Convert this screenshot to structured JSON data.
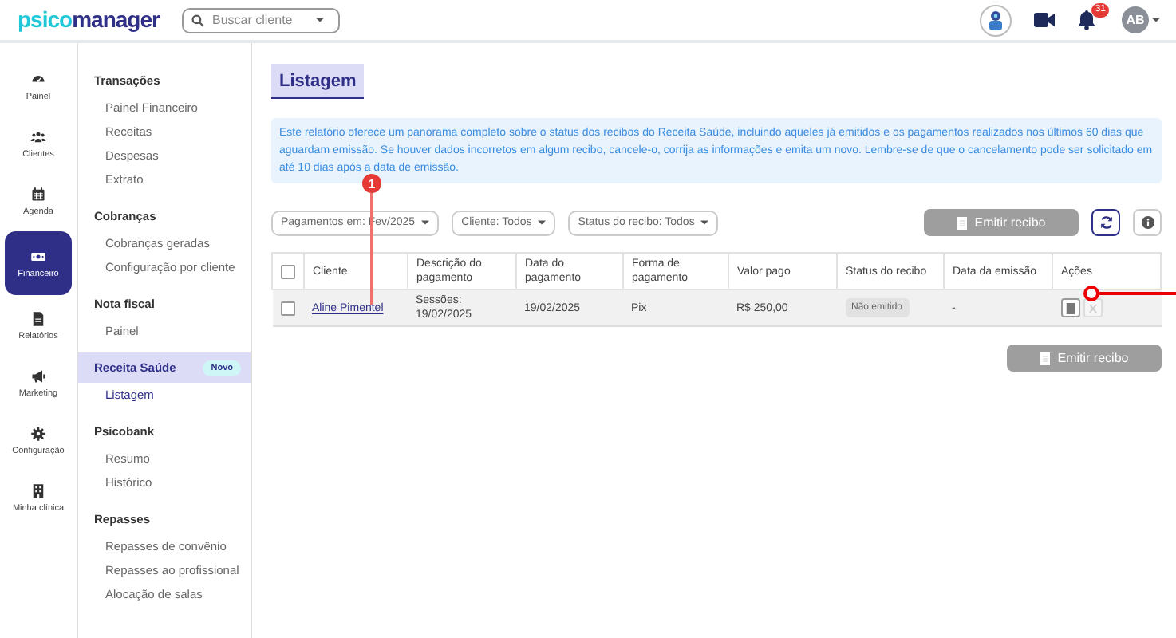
{
  "header": {
    "logo": {
      "prefix": "psico",
      "suffix": "manager"
    },
    "search": {
      "placeholder": "Buscar cliente"
    },
    "notifications": "31",
    "avatar": "AB"
  },
  "rail": [
    {
      "label": "Painel",
      "selected": false
    },
    {
      "label": "Clientes",
      "selected": false
    },
    {
      "label": "Agenda",
      "selected": false
    },
    {
      "label": "Financeiro",
      "selected": true
    },
    {
      "label": "Relatórios",
      "selected": false
    },
    {
      "label": "Marketing",
      "selected": false
    },
    {
      "label": "Configuração",
      "selected": false
    },
    {
      "label": "Minha clínica",
      "selected": false
    }
  ],
  "submenu": [
    {
      "title": "Transações",
      "selected": false,
      "items": [
        {
          "label": "Painel Financeiro",
          "selected": false
        },
        {
          "label": "Receitas",
          "selected": false
        },
        {
          "label": "Despesas",
          "selected": false
        },
        {
          "label": "Extrato",
          "selected": false
        }
      ]
    },
    {
      "title": "Cobranças",
      "selected": false,
      "items": [
        {
          "label": "Cobranças geradas",
          "selected": false
        },
        {
          "label": "Configuração por cliente",
          "selected": false
        }
      ]
    },
    {
      "title": "Nota fiscal",
      "selected": false,
      "items": [
        {
          "label": "Painel",
          "selected": false
        }
      ]
    },
    {
      "title": "Receita Saúde",
      "selected": true,
      "badge": "Novo",
      "items": [
        {
          "label": "Listagem",
          "selected": true
        }
      ]
    },
    {
      "title": "Psicobank",
      "selected": false,
      "items": [
        {
          "label": "Resumo",
          "selected": false
        },
        {
          "label": "Histórico",
          "selected": false
        }
      ]
    },
    {
      "title": "Repasses",
      "selected": false,
      "items": [
        {
          "label": "Repasses de convênio",
          "selected": false
        },
        {
          "label": "Repasses ao profissional",
          "selected": false
        },
        {
          "label": "Alocação de salas",
          "selected": false
        }
      ]
    }
  ],
  "page": {
    "title": "Listagem",
    "info": "Este relatório oferece um panorama completo sobre o status dos recibos do Receita Saúde, incluindo aqueles já emitidos e os pagamentos realizados nos últimos 60 dias que aguardam emissão. Se houver dados incorretos em algum recibo, cancele-o, corrija as informações e emita um novo. Lembre-se de que o cancelamento pode ser solicitado em até 10 dias após a data de emissão.",
    "filters": [
      "Pagamentos em: Fev/2025",
      "Cliente: Todos",
      "Status do recibo: Todos"
    ],
    "emit_button": {
      "label": "Emitir recibo",
      "disabled": true
    },
    "bottom_button": {
      "label": "Emitir recibo",
      "disabled": true
    }
  },
  "table": {
    "select_all": {
      "checked": false
    },
    "columns": [
      "Cliente",
      "Descrição do pagamento",
      "Data do pagamento",
      "Forma de pagamento",
      "Valor pago",
      "Status do recibo",
      "Data da emissão",
      "Ações"
    ],
    "rows": [
      {
        "checked": false,
        "client": "Aline Pimentel",
        "description": "Sessões: 19/02/2025",
        "date": "19/02/2025",
        "method": "Pix",
        "amount": "R$ 250,00",
        "status": "Não emitido",
        "issued": "-"
      }
    ]
  },
  "annotations": [
    {
      "label": "1"
    }
  ]
}
